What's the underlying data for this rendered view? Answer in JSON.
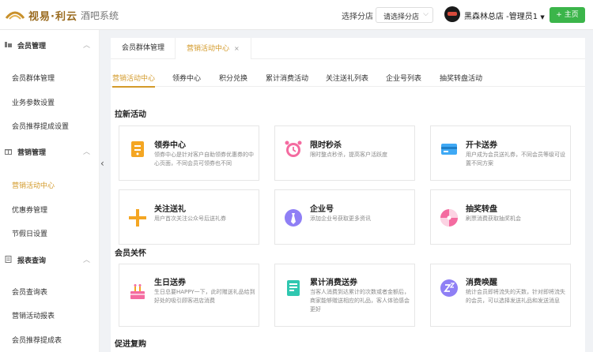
{
  "header": {
    "brand": "视易·利云",
    "system_name": "酒吧系统",
    "branch_label": "选择分店",
    "branch_placeholder": "请选择分店",
    "user": "黑森林总店 -管理员1",
    "home_button": "+ 主页"
  },
  "sidebar": {
    "sections": [
      {
        "label": "会员管理",
        "icon": "member-icon",
        "items": [
          "会员群体管理",
          "业务参数设置",
          "会员推荐提成设置"
        ]
      },
      {
        "label": "营销管理",
        "icon": "gift-icon",
        "items": [
          "营销活动中心",
          "优惠券管理",
          "节假日设置"
        ]
      },
      {
        "label": "报表查询",
        "icon": "report-icon",
        "items": [
          "会员查询表",
          "营销活动报表",
          "会员推荐提成表"
        ]
      }
    ],
    "active_item": "营销活动中心"
  },
  "page_tabs": [
    {
      "label": "会员群体管理"
    },
    {
      "label": "营销活动中心",
      "close": "×"
    }
  ],
  "sub_tabs": [
    "营销活动中心",
    "领券中心",
    "积分兑换",
    "累计消费活动",
    "关注送礼列表",
    "企业号列表",
    "抽奖转盘活动"
  ],
  "sections": [
    {
      "title": "拉新活动",
      "cards": [
        {
          "title": "领券中心",
          "desc": "领券中心是针对客户自助领券优惠券的中心页面，不同会员可领券也不同",
          "icon": "coupon-icon"
        },
        {
          "title": "限时秒杀",
          "desc": "限时整点秒杀，提高客户活跃度",
          "icon": "alarm-clock-icon"
        },
        {
          "title": "开卡送券",
          "desc": "用户成为会员送礼券，不同会员等级可设置不同方案",
          "icon": "card-icon"
        },
        {
          "title": "关注送礼",
          "desc": "用户首次关注公众号后送礼券",
          "icon": "plus-icon"
        },
        {
          "title": "企业号",
          "desc": "添加企业号获取更多资讯",
          "icon": "tie-icon"
        },
        {
          "title": "抽奖转盘",
          "desc": "刷票消费获取抽奖机会",
          "icon": "wheel-icon"
        }
      ]
    },
    {
      "title": "会员关怀",
      "cards": [
        {
          "title": "生日送券",
          "desc": "生日总要HAPPY一下，此时赠送礼品给到好处的吸引顾客进店消费",
          "icon": "cake-icon"
        },
        {
          "title": "累计消费送券",
          "desc": "当客人消费到达累计的次数或者金额后，商家能够赠送相应的礼品，客人体验感会更好",
          "icon": "receipt-icon"
        },
        {
          "title": "消费唤醒",
          "desc": "统计会员即将流失的天数，针对即将流失的会员，可以选择发送礼品和发送消息",
          "icon": "sleep-icon"
        }
      ]
    },
    {
      "title": "促进复购"
    }
  ],
  "colors": {
    "accent": "#d39a2a",
    "home_button": "#3bb54a"
  }
}
